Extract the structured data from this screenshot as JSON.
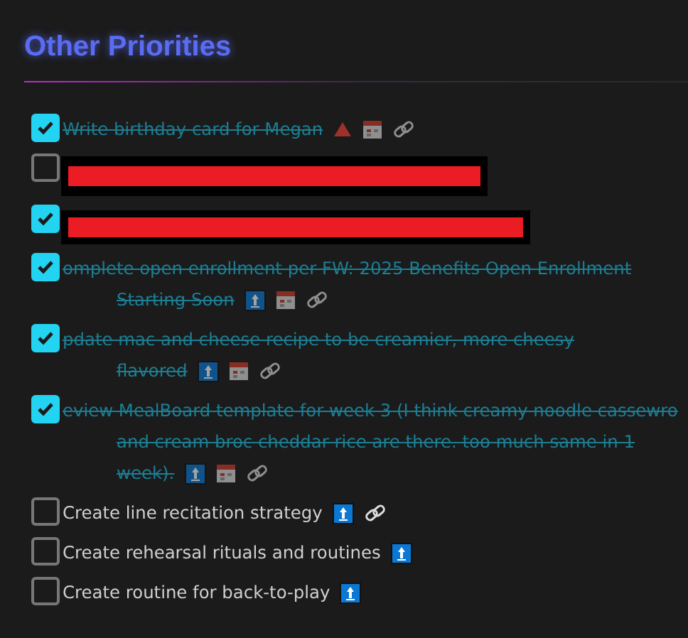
{
  "heading": "Other Priorities",
  "tasks": [
    {
      "kind": "task",
      "checked": true,
      "lines": [
        "Write birthday card for Megan"
      ],
      "badges": [
        {
          "kind": "triangle"
        },
        {
          "kind": "calendar"
        },
        {
          "kind": "link"
        }
      ]
    },
    {
      "kind": "redacted",
      "checked": false
    },
    {
      "kind": "redacted",
      "checked": true
    },
    {
      "kind": "task",
      "checked": true,
      "lines": [
        "omplete open enrollment per FW: 2025 Benefits Open Enrollment",
        "Starting Soon"
      ],
      "badges": [
        {
          "kind": "arrow"
        },
        {
          "kind": "calendar"
        },
        {
          "kind": "link"
        }
      ]
    },
    {
      "kind": "task",
      "checked": true,
      "lines": [
        "pdate mac and cheese recipe to be creamier, more cheesy",
        "flavored"
      ],
      "badges": [
        {
          "kind": "arrow"
        },
        {
          "kind": "calendar"
        },
        {
          "kind": "link"
        }
      ]
    },
    {
      "kind": "task",
      "checked": true,
      "lines": [
        "eview MealBoard template for week 3 (I think creamy noodle cassewro",
        "and cream broc cheddar rice are there. too much same in 1",
        "week)."
      ],
      "badges": [
        {
          "kind": "arrow"
        },
        {
          "kind": "calendar"
        },
        {
          "kind": "link"
        }
      ]
    },
    {
      "kind": "task",
      "checked": false,
      "lines": [
        "Create line recitation strategy"
      ],
      "badges": [
        {
          "kind": "arrow"
        },
        {
          "kind": "link"
        }
      ]
    },
    {
      "kind": "task",
      "checked": false,
      "lines": [
        "Create rehearsal rituals and routines"
      ],
      "badges": [
        {
          "kind": "arrow"
        }
      ]
    },
    {
      "kind": "task",
      "checked": false,
      "lines": [
        "Create routine for back-to-play"
      ],
      "badges": [
        {
          "kind": "arrow"
        }
      ]
    }
  ]
}
